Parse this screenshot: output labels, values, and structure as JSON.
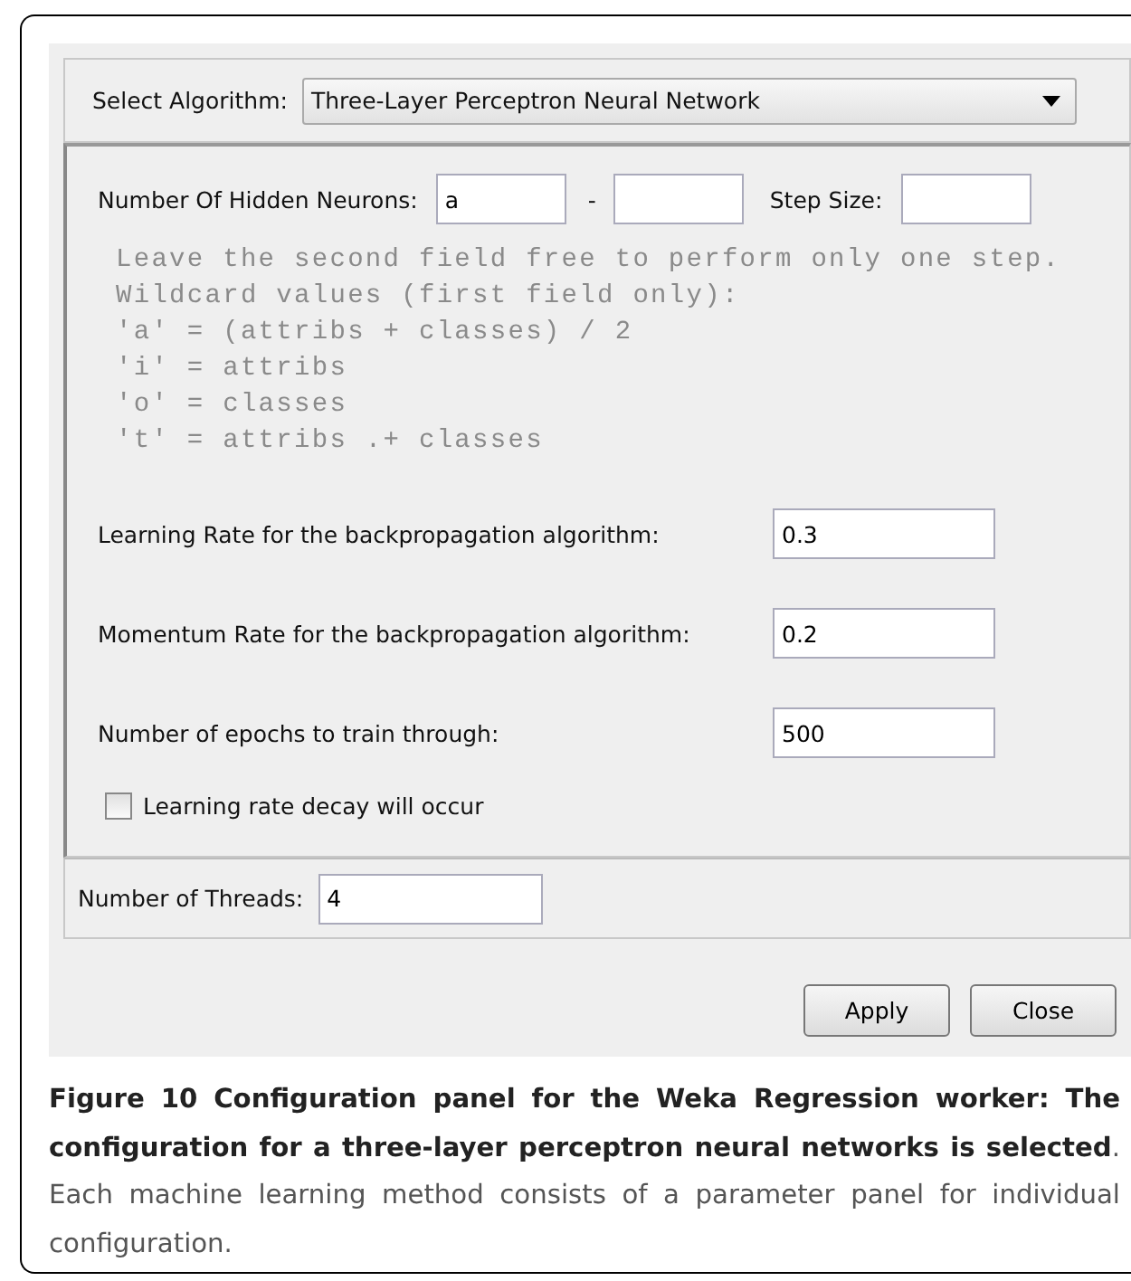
{
  "algorithm": {
    "label": "Select Algorithm:",
    "value": "Three-Layer Perceptron Neural Network"
  },
  "hidden_neurons": {
    "label": "Number Of Hidden Neurons:",
    "from": "a",
    "separator": "-",
    "step_label": "Step Size:"
  },
  "help_lines": [
    "Leave the second field free to perform only one step.",
    "Wildcard values (first field only):",
    "'a' = (attribs + classes) / 2",
    "'i' = attribs",
    "'o' = classes",
    "'t' = attribs .+ classes"
  ],
  "parameters": [
    {
      "label": "Learning Rate for the backpropagation algorithm:",
      "value": "0.3"
    },
    {
      "label": "Momentum Rate for the backpropagation algorithm:",
      "value": "0.2"
    },
    {
      "label": "Number of epochs to train through:",
      "value": "500"
    }
  ],
  "decay": {
    "label": "Learning rate decay will occur",
    "checked": false
  },
  "threads": {
    "label": "Number of Threads:",
    "value": "4"
  },
  "buttons": [
    "Apply",
    "Close"
  ],
  "caption": "**Figure 10 Configuration panel for the Weka Regression worker: The configuration for a three-layer perceptron neural networks is selected**. Each machine learning method consists of a parameter panel for individual configuration."
}
